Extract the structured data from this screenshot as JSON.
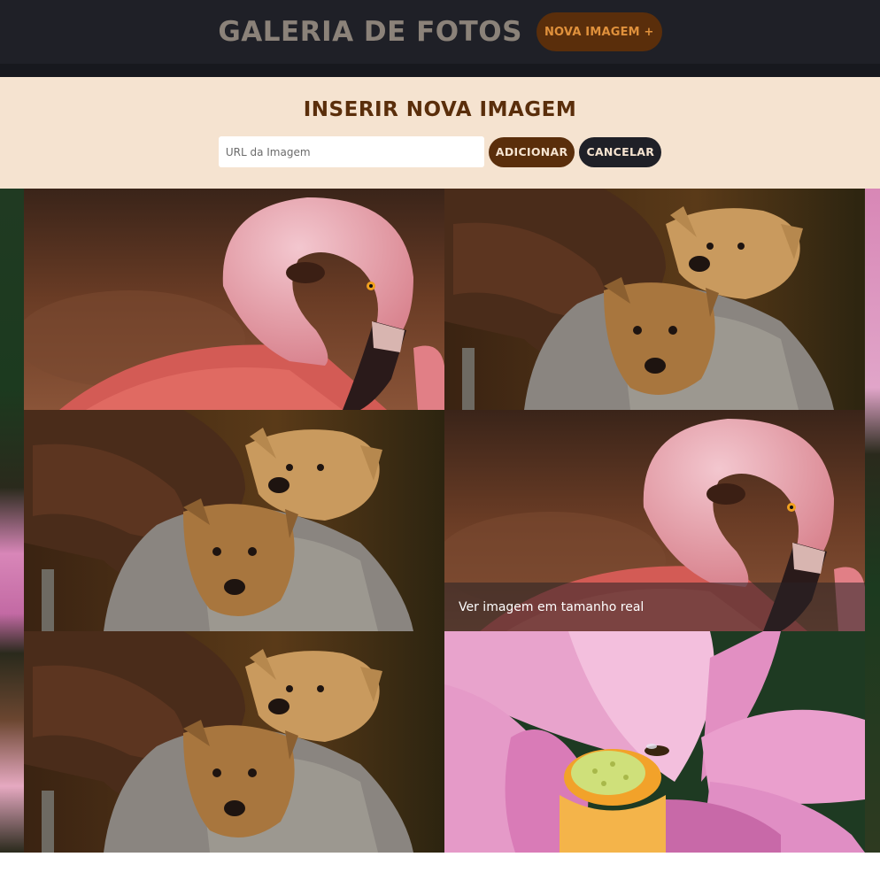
{
  "header": {
    "title": "GALERIA DE FOTOS",
    "new_image_label": "NOVA IMAGEM +"
  },
  "form": {
    "title": "INSERIR NOVA IMAGEM",
    "url_placeholder": "URL da Imagem",
    "url_value": "",
    "add_label": "ADICIONAR",
    "cancel_label": "CANCELAR"
  },
  "gallery": {
    "tiles": [
      {
        "subject": "flamingo"
      },
      {
        "subject": "puppies"
      },
      {
        "subject": "puppies"
      },
      {
        "subject": "flamingo",
        "hovered": true,
        "caption": "Ver imagem em tamanho real"
      },
      {
        "subject": "puppies"
      },
      {
        "subject": "lotus-flower"
      }
    ]
  },
  "colors": {
    "header_bg": "#1f2027",
    "title_color": "#8b8279",
    "accent_brown": "#5a2e0b",
    "accent_orange": "#e0913c",
    "form_bg": "#f5e3d0"
  }
}
